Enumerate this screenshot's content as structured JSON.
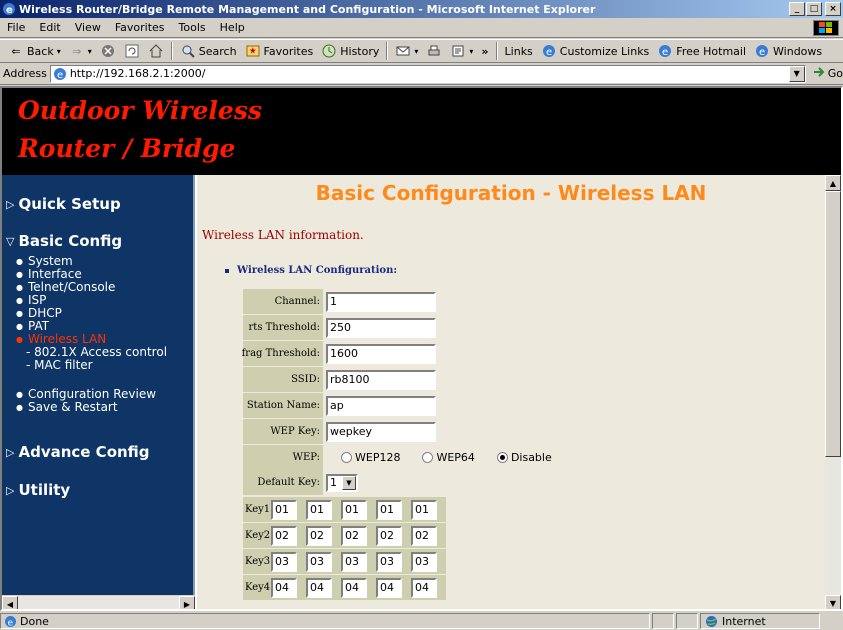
{
  "window": {
    "title": "Wireless Router/Bridge Remote Management and Configuration - Microsoft Internet Explorer",
    "controls": {
      "minimize": "_",
      "maximize": "□",
      "close": "×"
    }
  },
  "menu": [
    "File",
    "Edit",
    "View",
    "Favorites",
    "Tools",
    "Help"
  ],
  "toolbar": {
    "back": "Back",
    "search": "Search",
    "favorites": "Favorites",
    "history": "History",
    "links": "Links",
    "customize": "Customize Links",
    "hotmail": "Free Hotmail",
    "windows": "Windows"
  },
  "address": {
    "label": "Address",
    "url": "http://192.168.2.1:2000/",
    "go": "Go"
  },
  "banner": {
    "line1": "Outdoor Wireless",
    "line2": "Router / Bridge",
    "color": "#ff1a00"
  },
  "sidebar": {
    "quick_setup": "Quick Setup",
    "basic_config": "Basic Config",
    "basic_items": [
      "System",
      "Interface",
      "Telnet/Console",
      "ISP",
      "DHCP",
      "PAT",
      "Wireless LAN"
    ],
    "wireless_sub": [
      "- 802.1X Access control",
      "- MAC filter"
    ],
    "review_items": [
      "Configuration Review",
      "Save & Restart"
    ],
    "advance_config": "Advance Config",
    "utility": "Utility",
    "active_color": "#ff3300"
  },
  "content": {
    "page_title": "Basic Configuration - Wireless LAN",
    "section_title": "Wireless LAN information.",
    "subsection_title": "Wireless LAN Configuration:",
    "fields": {
      "channel": {
        "label": "Channel:",
        "value": "1"
      },
      "rts": {
        "label": "rts Threshold:",
        "value": "250"
      },
      "frag": {
        "label": "frag Threshold:",
        "value": "1600"
      },
      "ssid": {
        "label": "SSID:",
        "value": "rb8100"
      },
      "station": {
        "label": "Station Name:",
        "value": "ap"
      },
      "wep_key": {
        "label": "WEP Key:",
        "value": "wepkey"
      }
    },
    "wep": {
      "label": "WEP:",
      "options": [
        "WEP128",
        "WEP64",
        "Disable"
      ],
      "selected": "Disable"
    },
    "default_key": {
      "label": "Default Key:",
      "value": "1"
    },
    "keys": [
      {
        "label": "Key1:",
        "values": [
          "01",
          "01",
          "01",
          "01",
          "01"
        ]
      },
      {
        "label": "Key2:",
        "values": [
          "02",
          "02",
          "02",
          "02",
          "02"
        ]
      },
      {
        "label": "Key3:",
        "values": [
          "03",
          "03",
          "03",
          "03",
          "03"
        ]
      },
      {
        "label": "Key4:",
        "values": [
          "04",
          "04",
          "04",
          "04",
          "04"
        ]
      }
    ]
  },
  "status": {
    "text": "Done",
    "zone": "Internet"
  }
}
